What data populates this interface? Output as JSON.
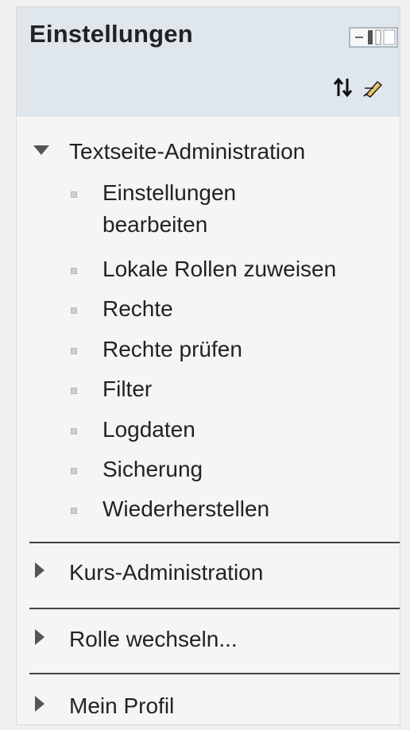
{
  "block": {
    "title": "Einstellungen",
    "dock_icon": "dock-block-icon",
    "move_icon": "move-icon",
    "edit_icon": "edit-icon"
  },
  "tree": {
    "expanded": {
      "label": "Textseite-Administration",
      "state": "expanded",
      "items": [
        {
          "label": "Einstellungen bearbeiten"
        },
        {
          "label": "Lokale Rollen zuweisen"
        },
        {
          "label": "Rechte"
        },
        {
          "label": "Rechte prüfen"
        },
        {
          "label": "Filter"
        },
        {
          "label": "Logdaten"
        },
        {
          "label": "Sicherung"
        },
        {
          "label": "Wiederherstellen"
        }
      ]
    },
    "collapsed": [
      {
        "label": "Kurs-Administration",
        "state": "collapsed"
      },
      {
        "label": "Rolle wechseln...",
        "state": "collapsed"
      },
      {
        "label": "Mein Profil",
        "state": "collapsed"
      }
    ]
  },
  "colors": {
    "header_bg": "#dfe6ec",
    "block_bg": "#f5f5f5",
    "divider": "#444444"
  }
}
